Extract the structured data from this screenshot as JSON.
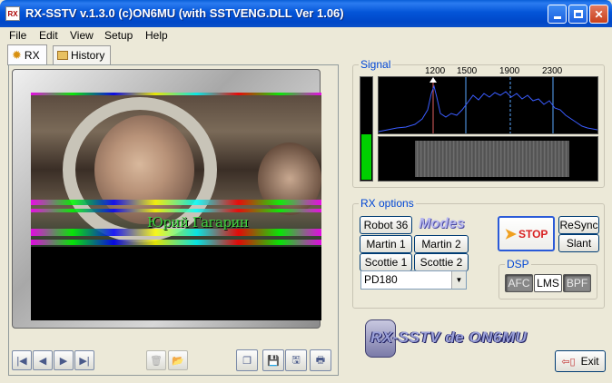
{
  "window": {
    "title": "RX-SSTV v.1.3.0 (c)ON6MU (with SSTVENG.DLL Ver 1.06)",
    "app_icon_text": "RX"
  },
  "menu": [
    "File",
    "Edit",
    "View",
    "Setup",
    "Help"
  ],
  "tabs": [
    {
      "label": "RX",
      "active": true
    },
    {
      "label": "History",
      "active": false
    }
  ],
  "image": {
    "caption": "Юрий Гагарин"
  },
  "signal": {
    "title": "Signal",
    "freq_labels": [
      "1200",
      "1500",
      "1900",
      "2300"
    ],
    "level": 0.45,
    "colors": {
      "meter": "#00d000",
      "trace": "#3a5cff",
      "markers": "#5aa8ff"
    }
  },
  "rx_options": {
    "title": "RX options",
    "mode_buttons": [
      "Robot 36",
      "Martin 1",
      "Martin 2",
      "Scottie 1",
      "Scottie 2"
    ],
    "modes_label": "Modes",
    "selected_mode": "PD180",
    "stop_label": "STOP",
    "resync_label": "ReSync",
    "slant_label": "Slant"
  },
  "dsp": {
    "title": "DSP",
    "buttons": [
      {
        "label": "AFC",
        "on": true
      },
      {
        "label": "LMS",
        "on": false
      },
      {
        "label": "BPF",
        "on": true
      }
    ]
  },
  "logo": {
    "text": "RX-SSTV de ON6MU"
  },
  "exit_label": "Exit",
  "controls": {
    "nav": [
      "first-icon",
      "prev-icon",
      "next-icon",
      "last-icon"
    ],
    "mid": [
      "trash-icon",
      "folder-icon"
    ],
    "right": [
      "copy-icon",
      "save-icon",
      "save-as-icon",
      "print-icon"
    ]
  }
}
